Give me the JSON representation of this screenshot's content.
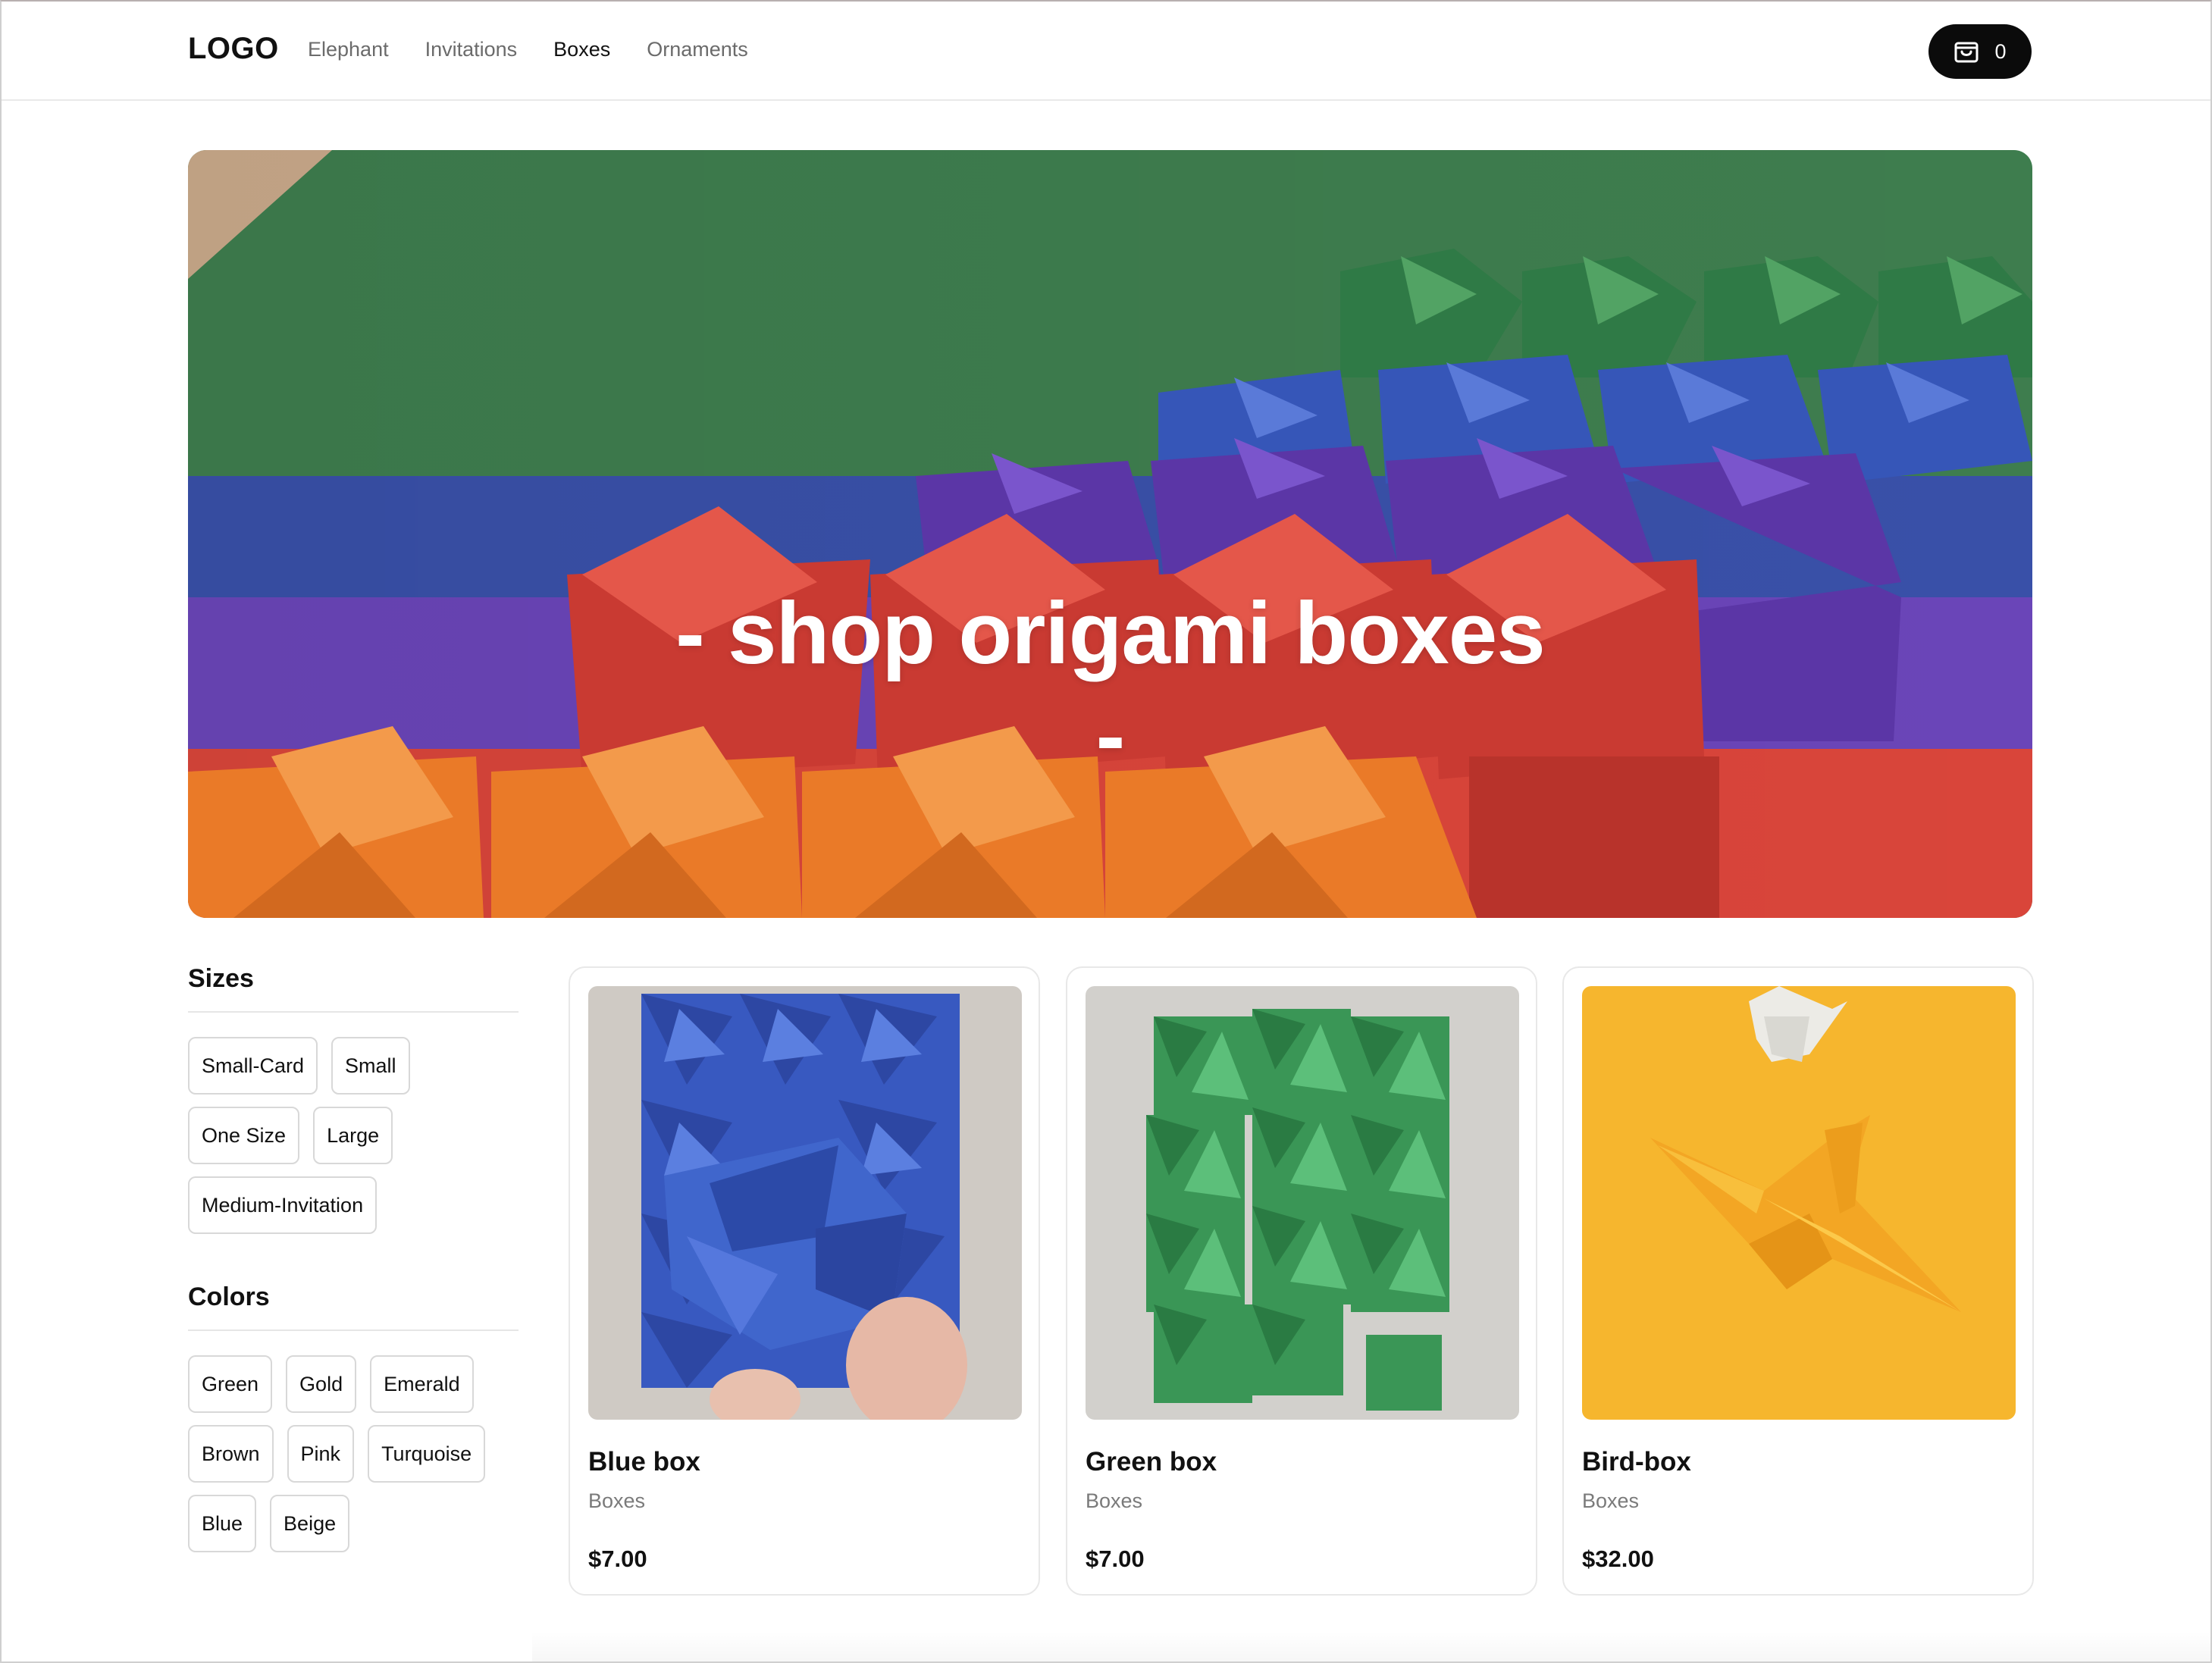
{
  "header": {
    "logo": "LOGO",
    "nav": [
      {
        "label": "Elephant",
        "active": false
      },
      {
        "label": "Invitations",
        "active": false
      },
      {
        "label": "Boxes",
        "active": true
      },
      {
        "label": "Ornaments",
        "active": false
      }
    ],
    "cart_count": "0",
    "cart_icon": "shopping-bag-icon"
  },
  "hero": {
    "title_line1": "- shop origami boxes",
    "title_line2": "-"
  },
  "filters": {
    "sizes": {
      "title": "Sizes",
      "options": [
        "Small-Card",
        "Small",
        "One Size",
        "Large",
        "Medium-Invitation"
      ]
    },
    "colors": {
      "title": "Colors",
      "options": [
        "Green",
        "Gold",
        "Emerald",
        "Brown",
        "Pink",
        "Turquoise",
        "Blue",
        "Beige"
      ]
    }
  },
  "products": [
    {
      "name": "Blue box",
      "category": "Boxes",
      "price": "$7.00",
      "accent": "#3f62c4"
    },
    {
      "name": "Green box",
      "category": "Boxes",
      "price": "$7.00",
      "accent": "#3e9a58"
    },
    {
      "name": "Bird-box",
      "category": "Boxes",
      "price": "$32.00",
      "accent": "#f6b62e"
    }
  ],
  "colors": {
    "hero_green": "#3e7d4e",
    "hero_blue": "#3950a8",
    "hero_purple": "#6a45b8",
    "hero_red": "#d9453a",
    "hero_orange": "#ee7f2b",
    "cart_bg": "#0b0b0b"
  }
}
